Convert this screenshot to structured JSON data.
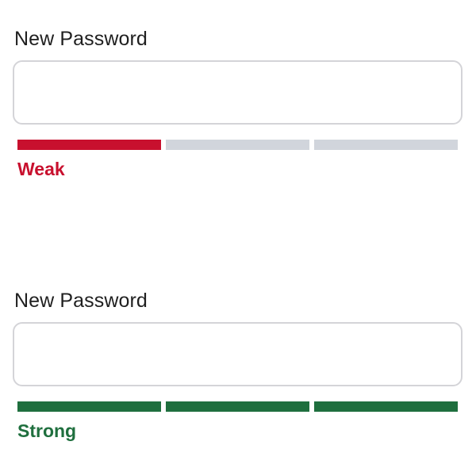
{
  "fields": [
    {
      "label": "New Password",
      "value": "",
      "placeholder": "",
      "strength_label": "Weak",
      "strength_level": 1,
      "segment_count": 3,
      "strength_color": "#c8102e",
      "empty_color": "#d1d5dc"
    },
    {
      "label": "New Password",
      "value": "",
      "placeholder": "",
      "strength_label": "Strong",
      "strength_level": 3,
      "segment_count": 3,
      "strength_color": "#1f6f3e",
      "empty_color": "#d1d5dc"
    }
  ]
}
